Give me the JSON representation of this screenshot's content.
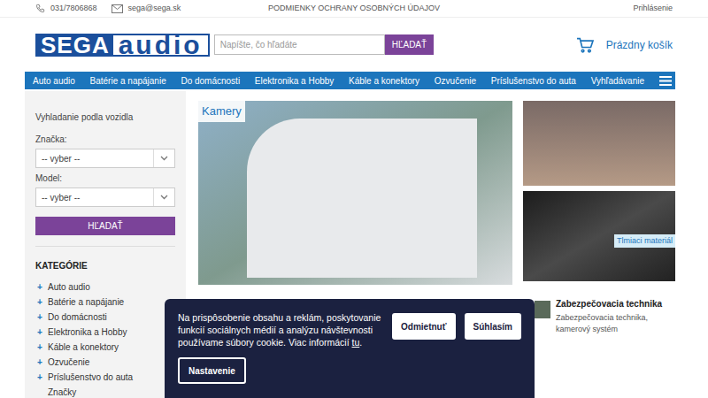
{
  "topbar": {
    "phone": "031/7806868",
    "email": "sega@sega.sk",
    "privacy": "PODMIENKY OCHRANY OSOBNÝCH ÚDAJOV",
    "login": "Prihlásenie"
  },
  "header": {
    "logo": {
      "left": "SEGA",
      "right": "audio"
    },
    "search": {
      "placeholder": "Napíšte, čo hľadáte",
      "button": "HĽADAŤ"
    },
    "cart": "Prázdny košík"
  },
  "nav": {
    "items": [
      "Auto audio",
      "Batérie a napájanie",
      "Do domácnosti",
      "Elektronika a Hobby",
      "Káble a konektory",
      "Ozvučenie",
      "Príslušenstvo do auta",
      "Vyhľadávanie"
    ]
  },
  "vehicle_search": {
    "title": "Vyhladanie podla vozidla",
    "brand_label": "Značka:",
    "brand_value": "-- vyber --",
    "model_label": "Model:",
    "model_value": "-- vyber --",
    "button": "HĽADAŤ"
  },
  "categories": {
    "title": "KATEGÓRIE",
    "items": [
      {
        "label": "Auto audio",
        "kind": "expandable",
        "marker": "+"
      },
      {
        "label": "Batérie a napájanie",
        "kind": "expandable",
        "marker": "+"
      },
      {
        "label": "Do domácnosti",
        "kind": "expandable",
        "marker": "+"
      },
      {
        "label": "Elektronika a Hobby",
        "kind": "expandable",
        "marker": "+"
      },
      {
        "label": "Káble a konektory",
        "kind": "expandable",
        "marker": "+"
      },
      {
        "label": "Ozvučenie",
        "kind": "expandable",
        "marker": "+"
      },
      {
        "label": "Príslušenstvo do auta",
        "kind": "expandable",
        "marker": "+"
      },
      {
        "label": "Značky",
        "kind": "link"
      }
    ]
  },
  "banners": {
    "main_label": "Kamery",
    "side_label": "Tlmiaci materiál"
  },
  "category_card": {
    "title": "Zabezpečovacia technika",
    "description": "Zabezpečovacia technika, kamerový systém"
  },
  "cookie": {
    "text": "Na prispôsobenie obsahu a reklám, poskytovanie funkcií sociálnych médií a analýzu návštevnosti používame súbory cookie. Viac informácií ",
    "link": "tu",
    "end": ".",
    "decline": "Odmietnuť",
    "accept": "Súhlasím",
    "settings": "Nastavenie"
  }
}
